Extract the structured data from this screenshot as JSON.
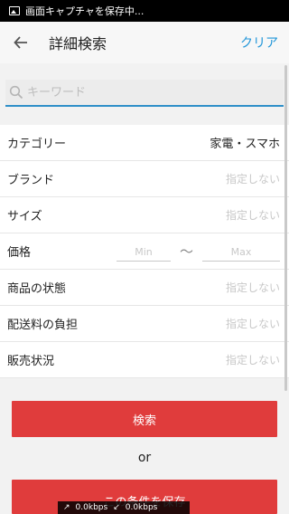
{
  "statusbar": {
    "text": "画面キャプチャを保存中..."
  },
  "appbar": {
    "title": "詳細検索",
    "clear_label": "クリア"
  },
  "search": {
    "placeholder": "キーワード"
  },
  "filters": {
    "category": {
      "label": "カテゴリー",
      "value": "家電・スマホ"
    },
    "brand": {
      "label": "ブランド",
      "value": "指定しない"
    },
    "size": {
      "label": "サイズ",
      "value": "指定しない"
    },
    "price": {
      "label": "価格",
      "min_placeholder": "Min",
      "tilde": "〜",
      "max_placeholder": "Max"
    },
    "condition": {
      "label": "商品の状態",
      "value": "指定しない"
    },
    "shipping": {
      "label": "配送料の負担",
      "value": "指定しない"
    },
    "status": {
      "label": "販売状況",
      "value": "指定しない"
    }
  },
  "buttons": {
    "search_label": "検索",
    "or_label": "or",
    "save_label": "この条件を保存"
  },
  "network": {
    "up": "0.0kbps",
    "down": "0.0kbps"
  },
  "colors": {
    "accent": "#2196d9",
    "primary_button": "#e03c3c"
  }
}
